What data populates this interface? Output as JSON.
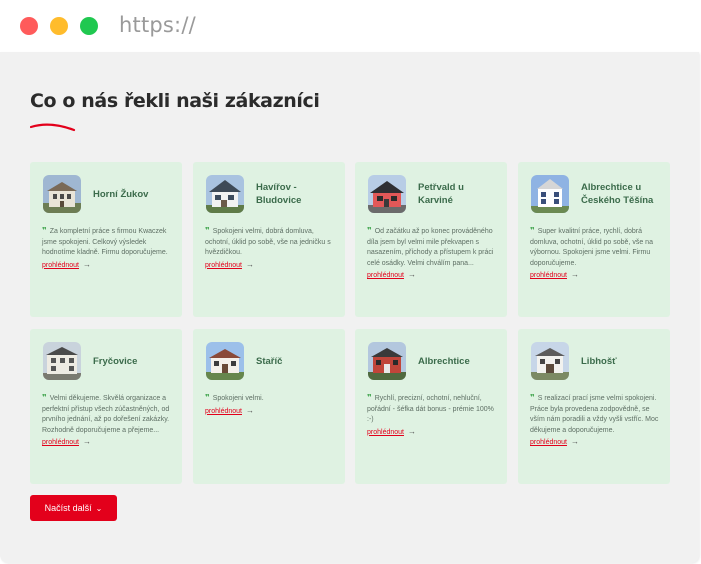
{
  "browser": {
    "url": "https://",
    "dot_colors": [
      "#ff5b5b",
      "#ffbc2c",
      "#20c850"
    ]
  },
  "section": {
    "heading": "Co o nás řekli naši zákazníci",
    "accent_color": "#e3001b",
    "card_color": "#dff2e2"
  },
  "reviews": [
    {
      "title": "Horní Žukov",
      "text": "Za kompletní práce s firmou Kwaczek jsme spokojeni. Celkový výsledek hodnotíme kladně. Firmu doporučujeme.",
      "link": "prohlédnout",
      "image": "house-photo"
    },
    {
      "title": "Havířov - Bludovice",
      "text": "Spokojeni velmi, dobrá domluva, ochotní, úklid po sobě, vše na jedničku s hvězdičkou.",
      "link": "prohlédnout",
      "image": "house-photo"
    },
    {
      "title": "Petřvald u Karviné",
      "text": "Od začátku až po konec prováděného díla jsem byl velmi mile překvapen s nasazením, příchody a přístupem k práci celé osádky. Velmi chválím pana...",
      "link": "prohlédnout",
      "image": "house-photo"
    },
    {
      "title": "Albrechtice u Českého Těšína",
      "text": "Super kvalitní práce, rychlí, dobrá domluva, ochotní, úklid po sobě, vše na výbornou. Spokojeni jsme velmi. Firmu doporučujeme.",
      "link": "prohlédnout",
      "image": "house-photo"
    },
    {
      "title": "Fryčovice",
      "text": "Velmi děkujeme. Skvělá organizace a perfektní přístup všech zúčastněných, od prvního jednání, až po dořešení zakázky. Rozhodně doporučujeme a přejeme...",
      "link": "prohlédnout",
      "image": "house-photo"
    },
    {
      "title": "Staříč",
      "text": "Spokojeni velmi.",
      "link": "prohlédnout",
      "image": "house-photo"
    },
    {
      "title": "Albrechtice",
      "text": "Rychlí, precizní, ochotní, nehluční, pořádní - šéfka dát bonus - prémie 100% :-)",
      "link": "prohlédnout",
      "image": "house-photo"
    },
    {
      "title": "Libhošť",
      "text": "S realizací prací jsme velmi spokojeni. Práce byla provedena zodpovědně, se vším nám poradili a vždy vyšli vstříc. Moc děkujeme a doporučujeme.",
      "link": "prohlédnout",
      "image": "house-photo"
    }
  ],
  "load_more": {
    "label": "Načíst další"
  }
}
